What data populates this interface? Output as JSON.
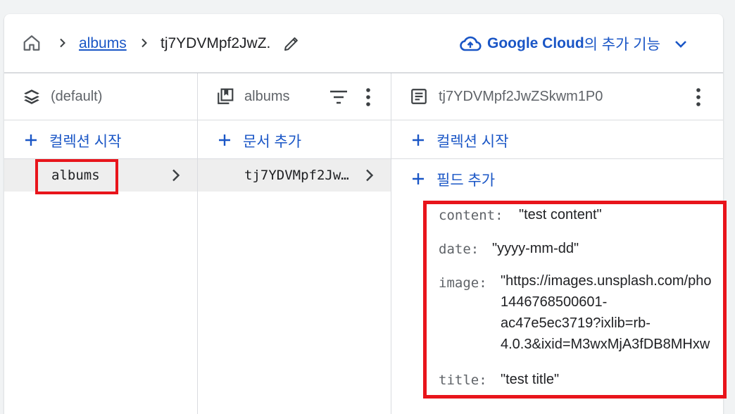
{
  "breadcrumb": {
    "collection_link": "albums",
    "document_id": "tj7YDVMpf2JwZ."
  },
  "google_cloud": {
    "brand": "Google Cloud",
    "suffix": "의 추가 기능"
  },
  "columns": {
    "root": {
      "title": "(default)",
      "add_label": "컬렉션 시작",
      "selected_item": "albums"
    },
    "collection": {
      "title": "albums",
      "add_label": "문서 추가",
      "selected_item": "tj7YDVMpf2Jw…"
    },
    "document": {
      "title": "tj7YDVMpf2JwZSkwm1P0",
      "add_collection_label": "컬렉션 시작",
      "add_field_label": "필드 추가",
      "fields": {
        "content": {
          "key": "content:",
          "value": "\"test content\""
        },
        "date": {
          "key": "date:",
          "value": "\"yyyy-mm-dd\""
        },
        "image": {
          "key": "image:",
          "lines": [
            "\"https://images.unsplash.com/pho",
            "1446768500601-",
            "ac47e5ec3719?ixlib=rb-",
            "4.0.3&ixid=M3wxMjA3fDB8MHxw"
          ]
        },
        "title": {
          "key": "title:",
          "value": "\"test title\""
        }
      }
    }
  },
  "colors": {
    "link_blue": "#1a56c6",
    "highlight_red": "#e8141b",
    "selected_row_bg": "#eeeeee"
  }
}
